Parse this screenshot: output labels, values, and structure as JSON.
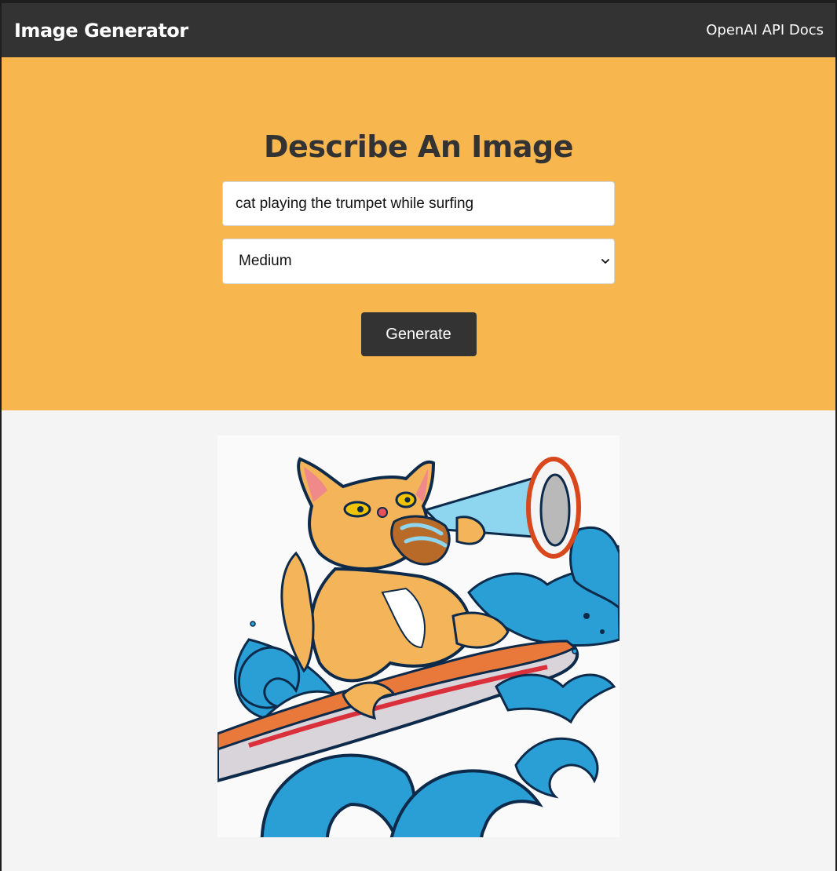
{
  "navbar": {
    "brand": "Image Generator",
    "docs_link": "OpenAI API Docs"
  },
  "hero": {
    "title": "Describe An Image",
    "prompt_value": "cat playing the trumpet while surfing",
    "size_select": {
      "selected": "Medium",
      "icon": "chevron-down-icon"
    },
    "generate_label": "Generate"
  },
  "result": {
    "image": "generated-image",
    "image_alt": "cat playing the trumpet while surfing"
  },
  "colors": {
    "navbar_bg": "#333333",
    "hero_bg": "#f8b64e",
    "page_bg": "#f4f4f4",
    "button_bg": "#333333",
    "text_dark": "#333333"
  }
}
